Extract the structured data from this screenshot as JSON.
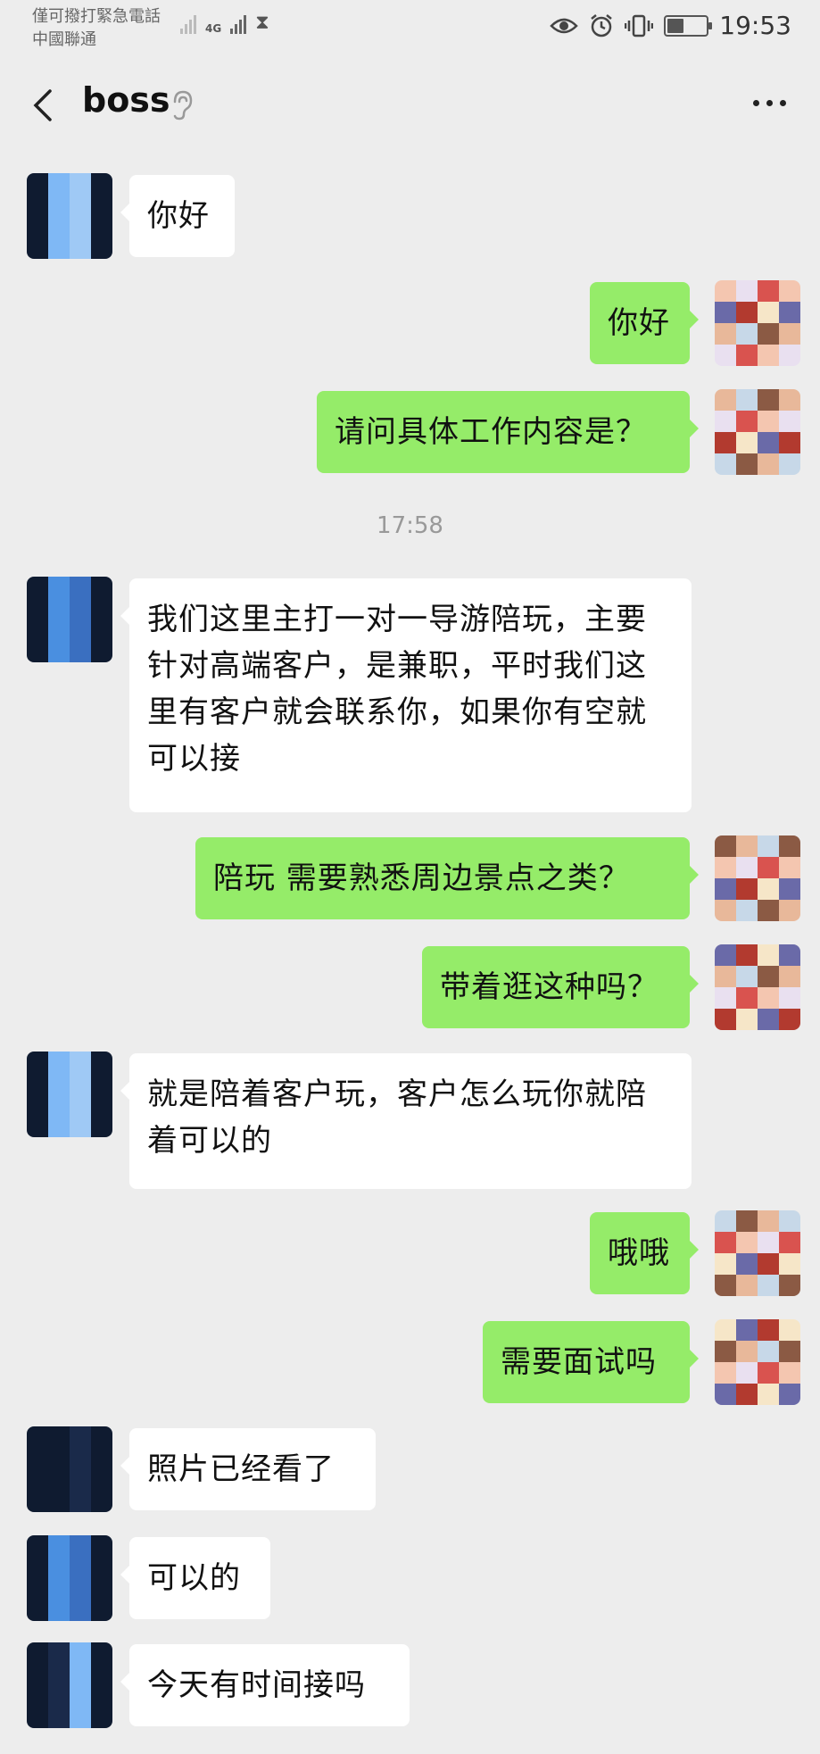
{
  "status_bar": {
    "carrier_line1": "僅可撥打緊急電話",
    "carrier_line2": "中國聯通",
    "net_tag": "4G",
    "time": "19:53",
    "icons": [
      "eye-icon",
      "alarm-icon",
      "vibrate-icon",
      "battery-icon"
    ]
  },
  "nav": {
    "title": "boss",
    "back_icon": "chevron-left-icon",
    "ear_icon": "ear-icon",
    "more_icon": "more-horizontal-icon"
  },
  "messages": [
    {
      "side": "left",
      "text": "你好"
    },
    {
      "side": "right",
      "text": "你好"
    },
    {
      "side": "right",
      "text": "请问具体工作内容是？"
    },
    {
      "side": "time",
      "text": "17:58"
    },
    {
      "side": "left",
      "text": "我们这里主打一对一导游陪玩，主要针对高端客户，是兼职，平时我们这里有客户就会联系你，如果你有空就可以接"
    },
    {
      "side": "right",
      "text": "陪玩  需要熟悉周边景点之类？"
    },
    {
      "side": "right",
      "text": "带着逛这种吗？"
    },
    {
      "side": "left",
      "text": "就是陪着客户玩，客户怎么玩你就陪着可以的"
    },
    {
      "side": "right",
      "text": "哦哦"
    },
    {
      "side": "right",
      "text": "需要面试吗"
    },
    {
      "side": "left",
      "text": "照片已经看了"
    },
    {
      "side": "left",
      "text": "可以的"
    },
    {
      "side": "left",
      "text": "今天有时间接吗"
    }
  ],
  "colors": {
    "background": "#ededed",
    "bubble_self": "#95ec69",
    "bubble_other": "#ffffff"
  }
}
